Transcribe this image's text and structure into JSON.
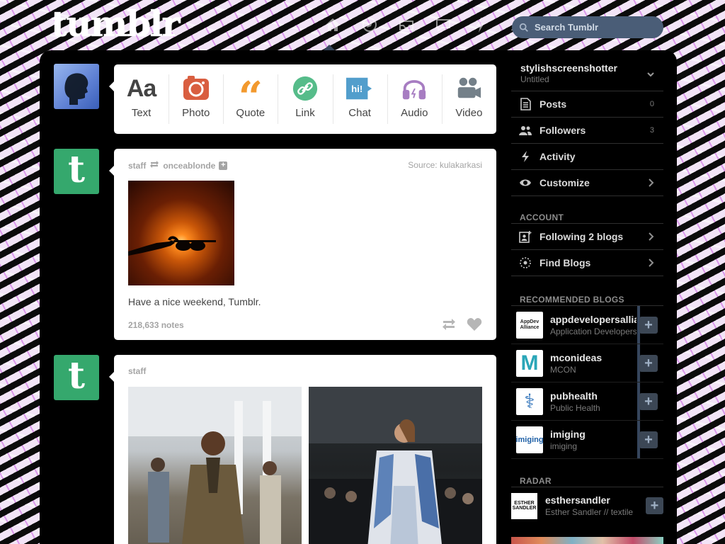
{
  "header": {
    "logo": "tumblr",
    "search_placeholder": "Search Tumblr",
    "nav_icons": [
      "home-icon",
      "explore-icon",
      "inbox-icon",
      "messaging-icon",
      "activity-icon",
      "account-icon"
    ]
  },
  "composer": {
    "items": [
      {
        "label": "Text",
        "glyph": "Aa",
        "icon": "text-icon",
        "color": "#444444"
      },
      {
        "label": "Photo",
        "icon": "camera-icon",
        "color": "#d95e40"
      },
      {
        "label": "Quote",
        "glyph": "“",
        "icon": "quote-icon",
        "color": "#f2992e"
      },
      {
        "label": "Link",
        "icon": "link-icon",
        "color": "#56bc8a"
      },
      {
        "label": "Chat",
        "glyph": "hi!",
        "icon": "chat-icon",
        "color": "#529ecc"
      },
      {
        "label": "Audio",
        "icon": "headphones-icon",
        "color": "#a77dc2"
      },
      {
        "label": "Video",
        "icon": "video-camera-icon",
        "color": "#748089"
      }
    ]
  },
  "posts": [
    {
      "author": "staff",
      "reblogged_from": "onceablonde",
      "source_label": "Source:",
      "source": "kulakarkasi",
      "caption": "Have a nice weekend, Tumblr.",
      "notes": "218,633 notes"
    },
    {
      "author": "staff"
    }
  ],
  "sidebar": {
    "blog_name": "stylishscreenshotter",
    "blog_subtitle": "Untitled",
    "rows": [
      {
        "label": "Posts",
        "count": "0",
        "icon": "posts-icon"
      },
      {
        "label": "Followers",
        "count": "3",
        "icon": "followers-icon"
      },
      {
        "label": "Activity",
        "icon": "lightning-icon"
      },
      {
        "label": "Customize",
        "icon": "eye-icon"
      }
    ],
    "account_title": "ACCOUNT",
    "account_rows": [
      {
        "label": "Following 2 blogs",
        "icon": "following-icon"
      },
      {
        "label": "Find Blogs",
        "icon": "find-blogs-icon"
      }
    ],
    "recommended_title": "RECOMMENDED BLOGS",
    "recommended": [
      {
        "name": "appdevelopersalliance",
        "desc": "Application Developers Alliance",
        "thumb_text": "AppDev Alliance"
      },
      {
        "name": "mconideas",
        "desc": "MCON",
        "thumb_text": "M"
      },
      {
        "name": "pubhealth",
        "desc": "Public Health",
        "thumb_text": "⚕"
      },
      {
        "name": "imiging",
        "desc": "imiging",
        "thumb_text": "imiging"
      }
    ],
    "radar_title": "RADAR",
    "radar": {
      "name": "esthersandler",
      "desc": "Esther Sandler // textile",
      "thumb_line1": "ESTHER",
      "thumb_line2": "SANDLER"
    },
    "follow_symbol": "+"
  },
  "colors": {
    "tumblr_green": "#35a86d",
    "navy": "#36465d",
    "sidebar_text": "#dcdcdc",
    "muted": "#a4a4a4"
  }
}
